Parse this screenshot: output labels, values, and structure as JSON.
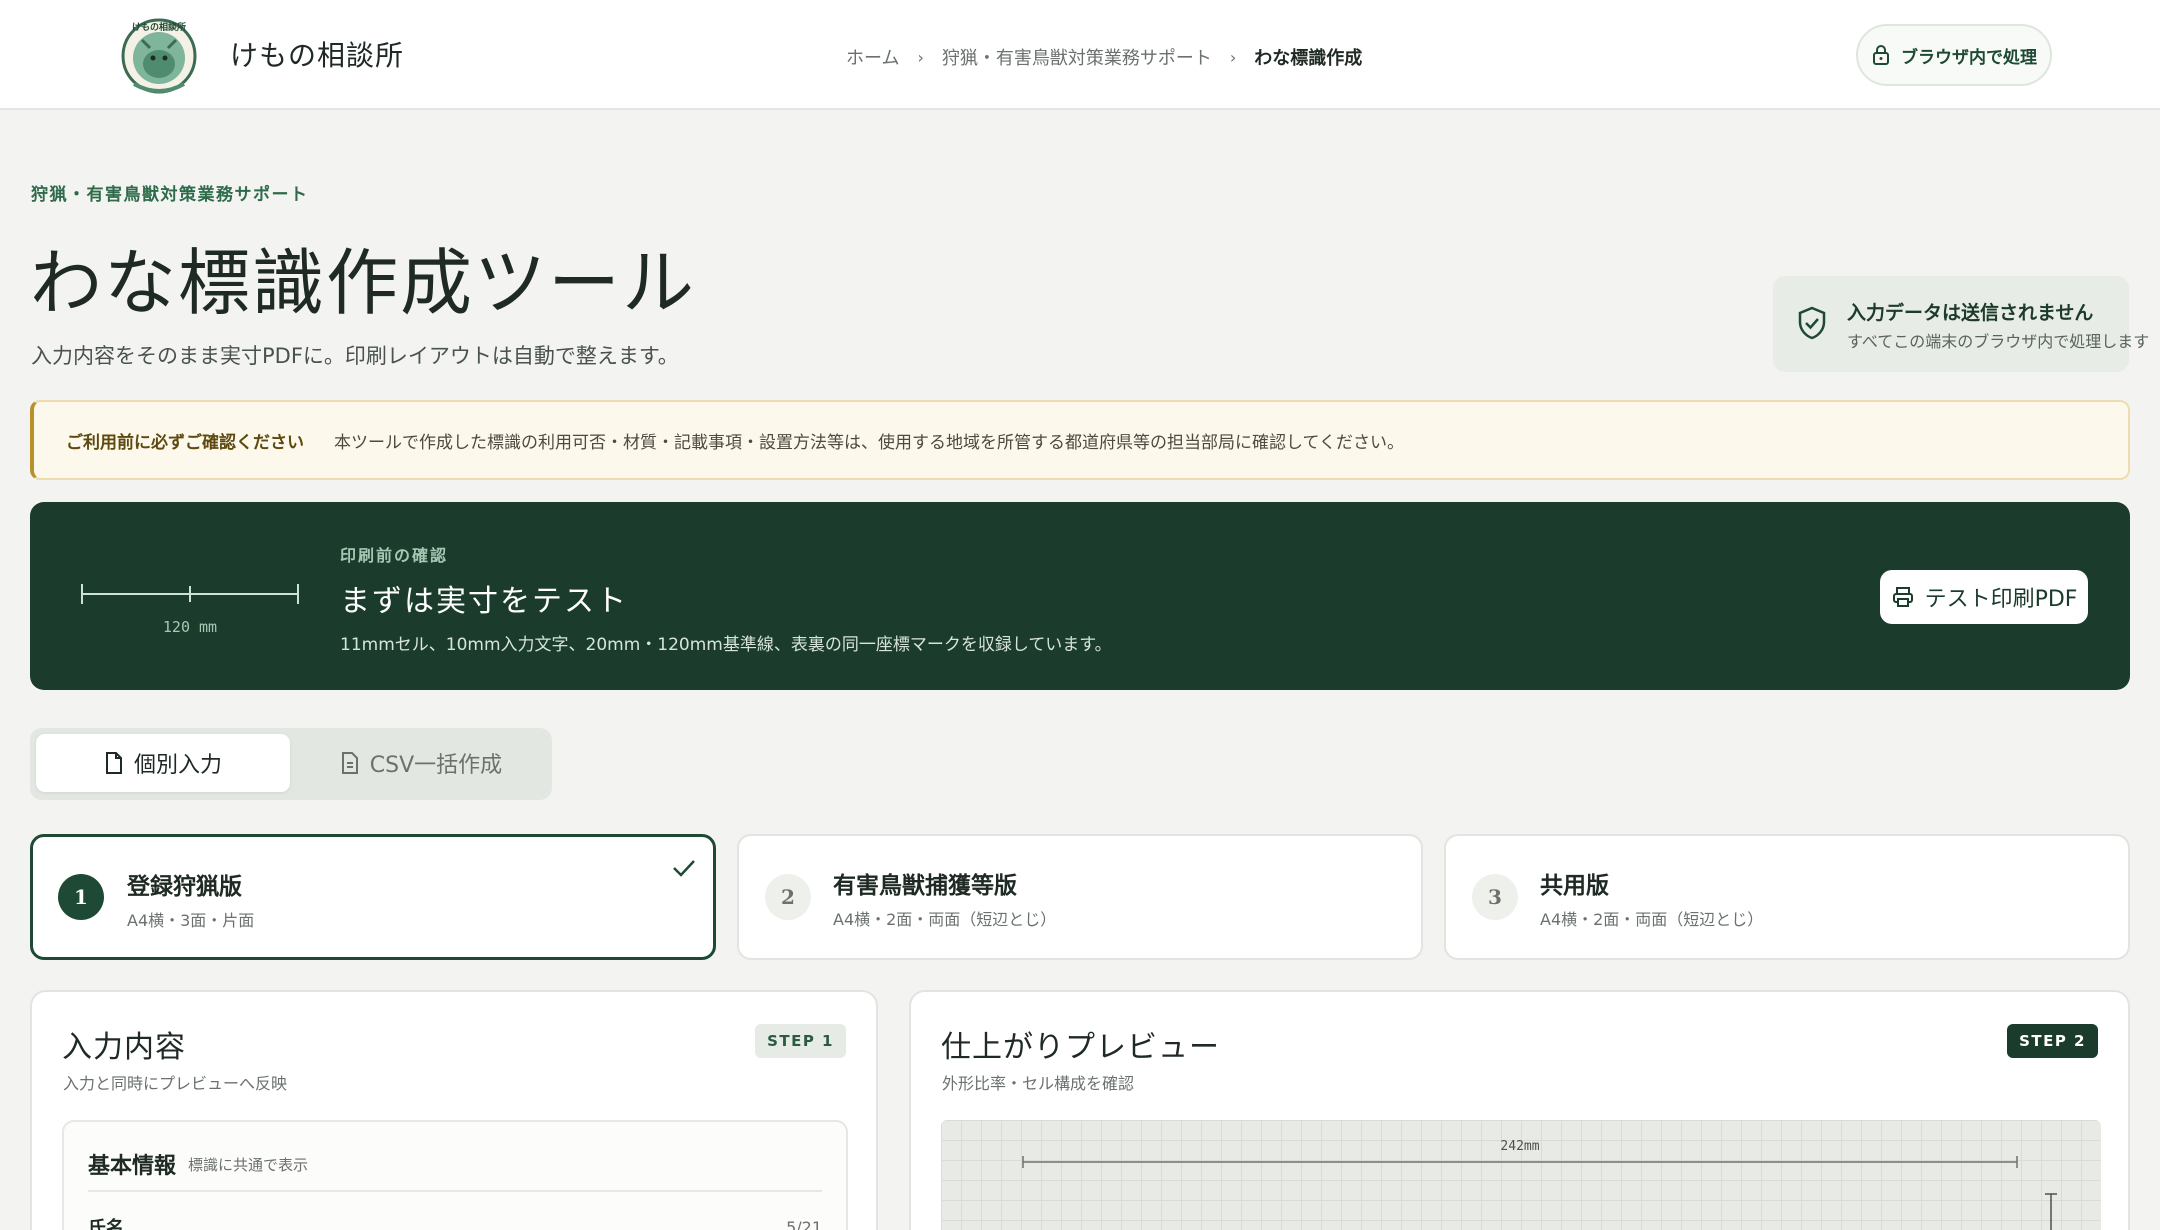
{
  "header": {
    "brand": "けもの相談所",
    "logo_text": "けもの相談所",
    "breadcrumb": [
      "ホーム",
      "狩猟・有害鳥獣対策業務サポート",
      "わな標識作成"
    ],
    "local_button": "ブラウザ内で処理"
  },
  "hero": {
    "eyebrow": "狩猟・有害鳥獣対策業務サポート",
    "title": "わな標識作成ツール",
    "subtitle": "入力内容をそのまま実寸PDFに。印刷レイアウトは自動で整えます。"
  },
  "privacy": {
    "title": "入力データは送信されません",
    "subtitle": "すべてこの端末のブラウザ内で処理します"
  },
  "notice": {
    "label": "ご利用前に必ずご確認ください",
    "text": "本ツールで作成した標識の利用可否・材質・記載事項・設置方法等は、使用する地域を所管する都道府県等の担当部局に確認してください。"
  },
  "banner": {
    "ruler_label": "120 mm",
    "eyebrow": "印刷前の確認",
    "title": "まずは実寸をテスト",
    "description": "11mmセル、10mm入力文字、20mm・120mm基準線、表裏の同一座標マークを収録しています。",
    "button": "テスト印刷PDF"
  },
  "tabs": [
    {
      "label": "個別入力",
      "active": true
    },
    {
      "label": "CSV一括作成",
      "active": false
    }
  ],
  "versions": [
    {
      "num": "1",
      "title": "登録狩猟版",
      "subtitle": "A4横・3面・片面",
      "selected": true
    },
    {
      "num": "2",
      "title": "有害鳥獣捕獲等版",
      "subtitle": "A4横・2面・両面（短辺とじ）",
      "selected": false
    },
    {
      "num": "3",
      "title": "共用版",
      "subtitle": "A4横・2面・両面（短辺とじ）",
      "selected": false
    }
  ],
  "input_panel": {
    "title": "入力内容",
    "subtitle": "入力と同時にプレビューへ反映",
    "step": "STEP 1",
    "section_title": "基本情報",
    "section_sub": "標識に共通で表示",
    "field_label": "氏名",
    "field_count": "5/21"
  },
  "preview_panel": {
    "title": "仕上がりプレビュー",
    "subtitle": "外形比率・セル構成を確認",
    "step": "STEP 2",
    "dimension": "242mm"
  },
  "colors": {
    "primary": "#1b3c2c",
    "accent": "#1e4a35",
    "notice_border": "#b8902e",
    "background": "#f3f4f1"
  }
}
